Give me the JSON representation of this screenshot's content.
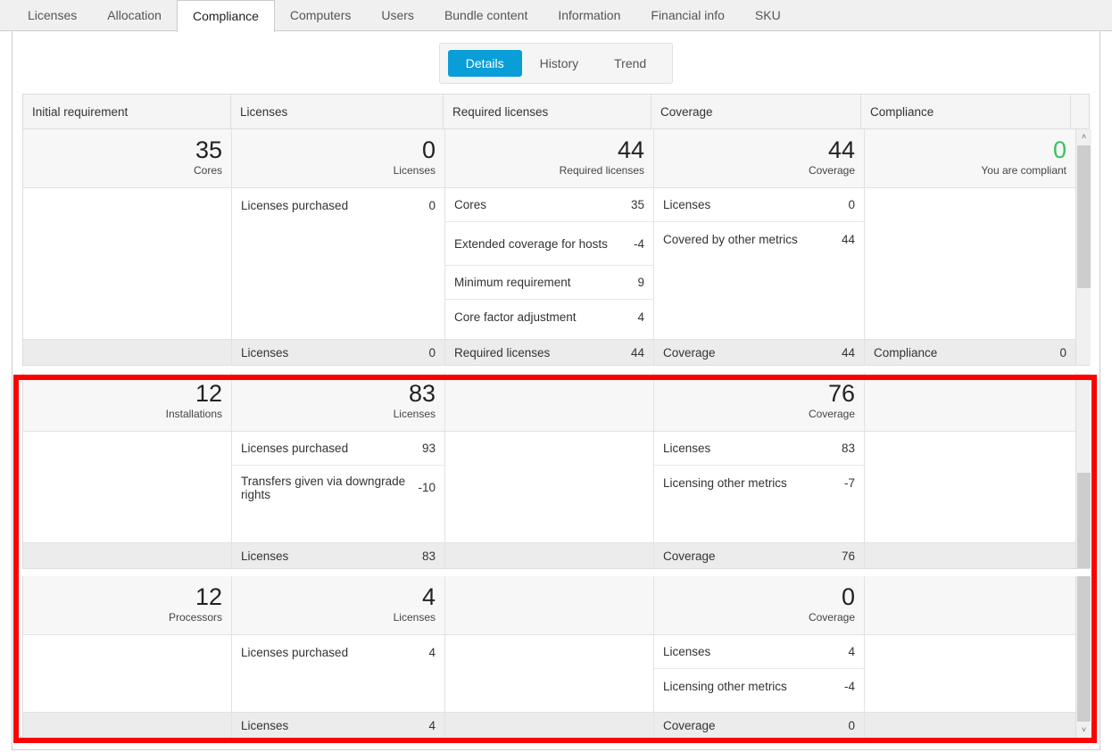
{
  "tabs": [
    {
      "label": "Licenses",
      "active": false
    },
    {
      "label": "Allocation",
      "active": false
    },
    {
      "label": "Compliance",
      "active": true
    },
    {
      "label": "Computers",
      "active": false
    },
    {
      "label": "Users",
      "active": false
    },
    {
      "label": "Bundle content",
      "active": false
    },
    {
      "label": "Information",
      "active": false
    },
    {
      "label": "Financial info",
      "active": false
    },
    {
      "label": "SKU",
      "active": false
    }
  ],
  "subtabs": [
    {
      "label": "Details",
      "active": true
    },
    {
      "label": "History",
      "active": false
    },
    {
      "label": "Trend",
      "active": false
    }
  ],
  "columns": [
    {
      "header": "Initial requirement"
    },
    {
      "header": "Licenses"
    },
    {
      "header": "Required licenses"
    },
    {
      "header": "Coverage"
    },
    {
      "header": "Compliance"
    }
  ],
  "accent_color": "#0a9ed9",
  "compliant_color": "#3ac162",
  "highlight_color": "#ff0000",
  "blocks": [
    {
      "id": "cores-block",
      "highlighted": false,
      "summary": [
        {
          "value": "35",
          "caption": "Cores",
          "green": false
        },
        {
          "value": "0",
          "caption": "Licenses",
          "green": false
        },
        {
          "value": "44",
          "caption": "Required licenses",
          "green": false
        },
        {
          "value": "44",
          "caption": "Coverage",
          "green": false
        },
        {
          "value": "0",
          "caption": "You are compliant",
          "green": true
        }
      ],
      "details": [
        [],
        [
          {
            "label": "Licenses purchased",
            "value": "0"
          }
        ],
        [
          {
            "label": "Cores",
            "value": "35"
          },
          {
            "label": "Extended coverage for hosts",
            "value": "-4"
          },
          {
            "label": "Minimum requirement",
            "value": "9"
          },
          {
            "label": "Core factor adjustment",
            "value": "4"
          }
        ],
        [
          {
            "label": "Licenses",
            "value": "0"
          },
          {
            "label": "Covered by other metrics",
            "value": "44"
          }
        ],
        []
      ],
      "totals": [
        {
          "label": "",
          "value": ""
        },
        {
          "label": "Licenses",
          "value": "0"
        },
        {
          "label": "Required licenses",
          "value": "44"
        },
        {
          "label": "Coverage",
          "value": "44"
        },
        {
          "label": "Compliance",
          "value": "0"
        }
      ]
    },
    {
      "id": "installations-block",
      "highlighted": true,
      "summary": [
        {
          "value": "12",
          "caption": "Installations",
          "green": false
        },
        {
          "value": "83",
          "caption": "Licenses",
          "green": false
        },
        {
          "value": "",
          "caption": "",
          "green": false
        },
        {
          "value": "76",
          "caption": "Coverage",
          "green": false
        },
        {
          "value": "",
          "caption": "",
          "green": false
        }
      ],
      "details": [
        [],
        [
          {
            "label": "Licenses purchased",
            "value": "93"
          },
          {
            "label": "Transfers given via downgrade rights",
            "value": "-10"
          }
        ],
        [],
        [
          {
            "label": "Licenses",
            "value": "83"
          },
          {
            "label": "Licensing other metrics",
            "value": "-7"
          }
        ],
        []
      ],
      "totals": [
        {
          "label": "",
          "value": ""
        },
        {
          "label": "Licenses",
          "value": "83"
        },
        {
          "label": "",
          "value": ""
        },
        {
          "label": "Coverage",
          "value": "76"
        },
        {
          "label": "",
          "value": ""
        }
      ]
    },
    {
      "id": "processors-block",
      "highlighted": true,
      "summary": [
        {
          "value": "12",
          "caption": "Processors",
          "green": false
        },
        {
          "value": "4",
          "caption": "Licenses",
          "green": false
        },
        {
          "value": "",
          "caption": "",
          "green": false
        },
        {
          "value": "0",
          "caption": "Coverage",
          "green": false
        },
        {
          "value": "",
          "caption": "",
          "green": false
        }
      ],
      "details": [
        [],
        [
          {
            "label": "Licenses purchased",
            "value": "4"
          }
        ],
        [],
        [
          {
            "label": "Licenses",
            "value": "4"
          },
          {
            "label": "Licensing other metrics",
            "value": "-4"
          }
        ],
        []
      ],
      "totals": [
        {
          "label": "",
          "value": ""
        },
        {
          "label": "Licenses",
          "value": "4"
        },
        {
          "label": "",
          "value": ""
        },
        {
          "label": "Coverage",
          "value": "0"
        },
        {
          "label": "",
          "value": ""
        }
      ]
    }
  ],
  "scrollbars": {
    "up_arrow": "˄",
    "down_arrow": "˅"
  }
}
